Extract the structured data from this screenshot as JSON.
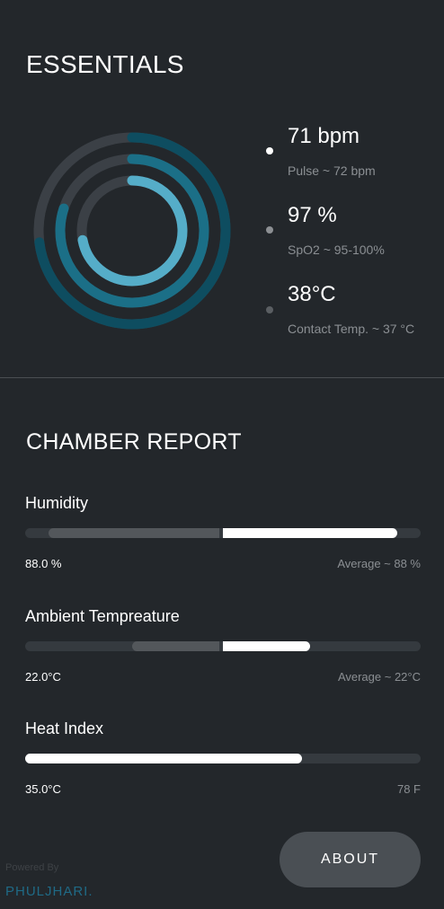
{
  "essentials": {
    "title": "ESSENTIALS",
    "vitals": [
      {
        "value": "71 bpm",
        "note": "Pulse ~ 72 bpm"
      },
      {
        "value": "97 %",
        "note": "SpO2 ~ 95-100%"
      },
      {
        "value": "38°C",
        "note": "Contact Temp. ~ 37 °C"
      }
    ],
    "rings": [
      {
        "fraction": 0.73,
        "color": "#0e4d60",
        "track": "#3b4046"
      },
      {
        "fraction": 0.8,
        "color": "#1b6f87",
        "track": "#3b4046"
      },
      {
        "fraction": 0.72,
        "color": "#55adc8",
        "track": "#3b4046"
      }
    ]
  },
  "chamber": {
    "title": "CHAMBER REPORT",
    "metrics": [
      {
        "label": "Humidity",
        "value": "88.0 %",
        "average": "Average ~ 88 %",
        "range_start": 0.06,
        "range_end": 0.49,
        "fill_start": 0.5,
        "fill_end": 0.94
      },
      {
        "label": "Ambient Tempreature",
        "value": "22.0°C",
        "average": "Average ~ 22°C",
        "range_start": 0.27,
        "range_end": 0.49,
        "fill_start": 0.5,
        "fill_end": 0.72
      },
      {
        "label": "Heat Index",
        "value": "35.0°C",
        "average": "78 F",
        "range_start": 0,
        "range_end": 0,
        "fill_start": 0,
        "fill_end": 0.7
      }
    ]
  },
  "footer": {
    "about_label": "ABOUT",
    "powered_by": "Powered By",
    "brand": "PHULJHARI."
  }
}
